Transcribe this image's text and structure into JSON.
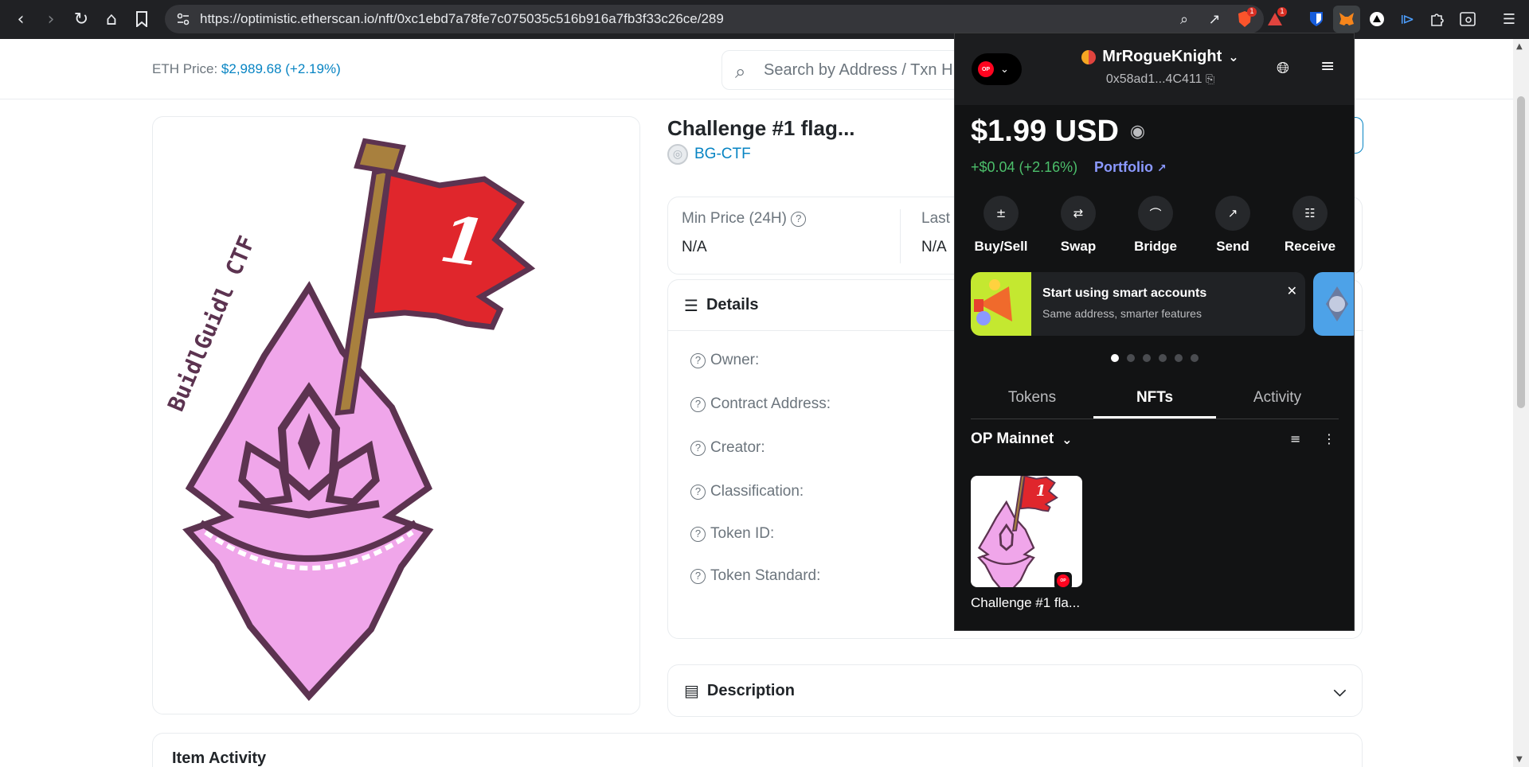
{
  "browser": {
    "url_host": "https://optimistic.etherscan.io",
    "url_path": "/nft/0xc1ebd7a78fe7c075035c516b916a7fb3f33c26ce/289",
    "badges": {
      "brave": "1",
      "rewards": "1"
    }
  },
  "header": {
    "eth_price_label": "ETH Price:",
    "eth_price_value": "$2,989.68 (+2.19%)",
    "search_placeholder": "Search by Address / Txn H"
  },
  "nft": {
    "title": "Challenge #1 flag...",
    "collection": "BG-CTF",
    "image_text": {
      "flag_number": "1",
      "watermark": "BuidlGuidl CTF"
    },
    "prices": [
      {
        "label": "Min Price (24H)",
        "value": "N/A"
      },
      {
        "label": "Last",
        "value": "N/A"
      }
    ],
    "details_title": "Details",
    "details_rows": [
      "Owner:",
      "Contract Address:",
      "Creator:",
      "Classification:",
      "Token ID:",
      "Token Standard:"
    ],
    "description_title": "Description",
    "item_activity_title": "Item Activity"
  },
  "metamask": {
    "network_badge": "OP",
    "account_name": "MrRogueKnight",
    "account_address": "0x58ad1...4C411",
    "balance": "$1.99 USD",
    "change": "+$0.04 (+2.16%)",
    "portfolio_label": "Portfolio",
    "actions": [
      {
        "label": "Buy/Sell",
        "icon": "plus-minus-icon"
      },
      {
        "label": "Swap",
        "icon": "swap-icon"
      },
      {
        "label": "Bridge",
        "icon": "bridge-icon"
      },
      {
        "label": "Send",
        "icon": "send-arrow-icon"
      },
      {
        "label": "Receive",
        "icon": "qr-code-icon"
      }
    ],
    "promo_title": "Start using smart accounts",
    "promo_subtitle": "Same address, smarter features",
    "carousel_dots": 6,
    "carousel_active": 1,
    "tabs": [
      "Tokens",
      "NFTs",
      "Activity"
    ],
    "active_tab": "NFTs",
    "network_filter": "OP Mainnet",
    "nft_item_name": "Challenge #1 fla...",
    "nft_item_badge": "OP"
  }
}
